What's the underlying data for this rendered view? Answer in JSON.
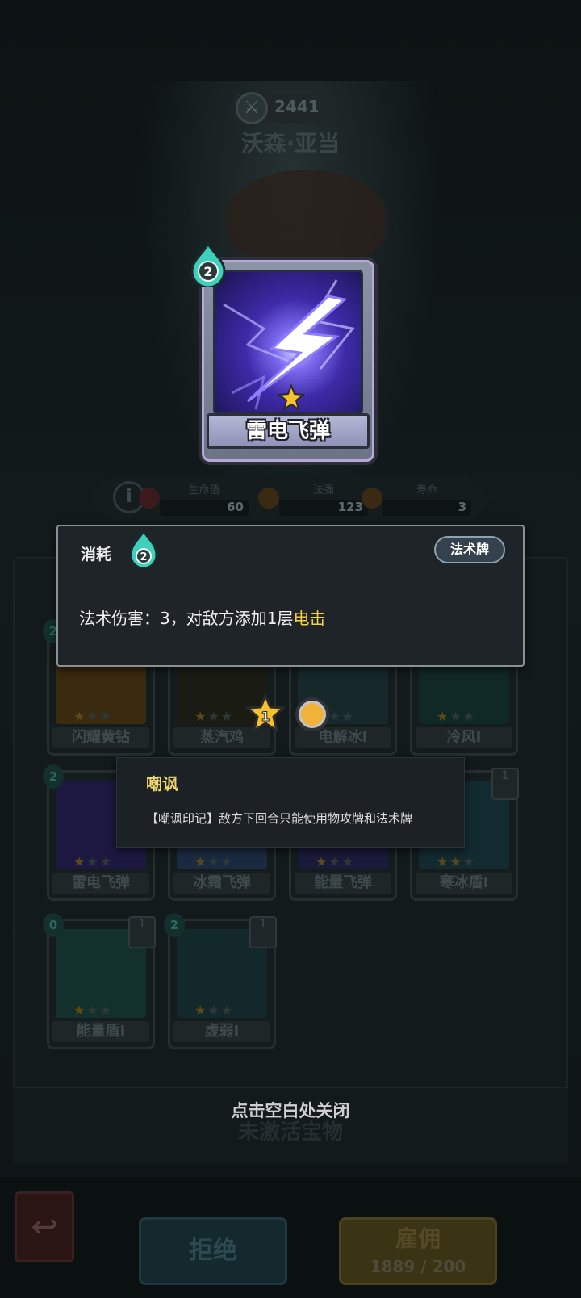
{
  "hero": {
    "score": "2441",
    "name": "沃森·亚当"
  },
  "stats": [
    {
      "label": "生命值",
      "value": "60"
    },
    {
      "label": "法强",
      "value": "123"
    },
    {
      "label": "寿命",
      "value": "3"
    }
  ],
  "focus_card": {
    "name": "雷电飞弹",
    "cost": "2",
    "stars": 1
  },
  "tooltip": {
    "cost_label": "消耗",
    "cost_value": "2",
    "type_badge": "法术牌",
    "desc_prefix": "法术伤害：3，对敌方添加1层",
    "desc_highlight": "电击"
  },
  "badges": {
    "star_level": "1"
  },
  "keyword": {
    "title": "嘲讽",
    "description": "【嘲讽印记】敌方下回合只能使用物攻牌和法术牌"
  },
  "deck": {
    "row1": [
      {
        "name": "闪耀黄钻",
        "cost": "2"
      },
      {
        "name": "蒸汽鸡",
        "cost": ""
      },
      {
        "name": "电解冰I",
        "cost": ""
      },
      {
        "name": "冷风I",
        "cost": ""
      }
    ],
    "row2": [
      {
        "name": "雷电飞弹",
        "cost": "2"
      },
      {
        "name": "冰霜飞弹",
        "cost": ""
      },
      {
        "name": "能量飞弹",
        "cost": ""
      },
      {
        "name": "寒冰盾I",
        "cost": "",
        "stack": "1"
      }
    ],
    "row3": [
      {
        "name": "能量盾I",
        "cost": "0",
        "stack": "1"
      },
      {
        "name": "虚弱I",
        "cost": "2",
        "stack": "1"
      }
    ]
  },
  "close_hint": "点击空白处关闭",
  "underlay_hint": "未激活宝物",
  "buttons": {
    "reject": "拒绝",
    "hire": "雇佣",
    "hire_price": "1889 / 200"
  },
  "colors": {
    "highlight": "#f4d14a",
    "keyword_title": "#f0d66c",
    "coin": "#f1b23a"
  }
}
